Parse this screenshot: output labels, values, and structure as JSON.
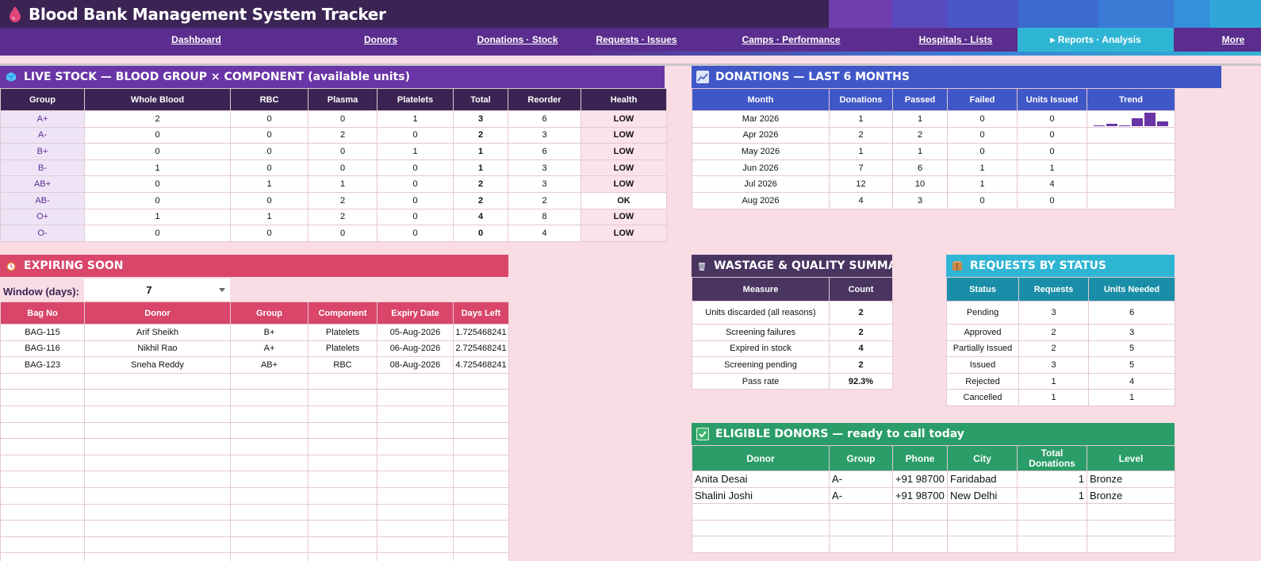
{
  "app": {
    "title": "Blood Bank Management System Tracker"
  },
  "nav": [
    {
      "label": "Dashboard"
    },
    {
      "label": "Donors"
    },
    {
      "label": "Donations · Stock"
    },
    {
      "label": "Requests · Issues"
    },
    {
      "label": "Camps · Performance"
    },
    {
      "label": "Hospitals · Lists"
    },
    {
      "label": "▸ Reports · Analysis"
    },
    {
      "label": "More"
    }
  ],
  "colors": {
    "header_dark": "#3b2453",
    "accent_purple": "#5b2d8e",
    "accent_blue": "#4057c7",
    "expiring_red": "#d9466a",
    "eligible_green": "#2a9d68",
    "requests_teal": "#2fb5d4"
  },
  "live_stock": {
    "title": "LIVE STOCK — BLOOD GROUP × COMPONENT (available units)",
    "icon": "cube-icon",
    "headers": [
      "Group",
      "Whole Blood",
      "RBC",
      "Plasma",
      "Platelets",
      "Total",
      "Reorder",
      "Health"
    ],
    "rows": [
      [
        "A+",
        "2",
        "0",
        "0",
        "1",
        "3",
        "6",
        "LOW"
      ],
      [
        "A-",
        "0",
        "0",
        "2",
        "0",
        "2",
        "3",
        "LOW"
      ],
      [
        "B+",
        "0",
        "0",
        "0",
        "1",
        "1",
        "6",
        "LOW"
      ],
      [
        "B-",
        "1",
        "0",
        "0",
        "0",
        "1",
        "3",
        "LOW"
      ],
      [
        "AB+",
        "0",
        "1",
        "1",
        "0",
        "2",
        "3",
        "LOW"
      ],
      [
        "AB-",
        "0",
        "0",
        "2",
        "0",
        "2",
        "2",
        "OK"
      ],
      [
        "O+",
        "1",
        "1",
        "2",
        "0",
        "4",
        "8",
        "LOW"
      ],
      [
        "O-",
        "0",
        "0",
        "0",
        "0",
        "0",
        "4",
        "LOW"
      ]
    ]
  },
  "donations": {
    "title": "DONATIONS — LAST 6 MONTHS",
    "icon": "chart-icon",
    "headers": [
      "Month",
      "Donations",
      "Passed",
      "Failed",
      "Units Issued",
      "Trend"
    ],
    "rows": [
      [
        "Mar 2026",
        "1",
        "1",
        "0",
        "0"
      ],
      [
        "Apr 2026",
        "2",
        "2",
        "0",
        "0"
      ],
      [
        "May 2026",
        "1",
        "1",
        "0",
        "0"
      ],
      [
        "Jun 2026",
        "7",
        "6",
        "1",
        "1"
      ],
      [
        "Jul 2026",
        "12",
        "10",
        "1",
        "4"
      ],
      [
        "Aug 2026",
        "4",
        "3",
        "0",
        "0"
      ]
    ],
    "trend_values": [
      1,
      2,
      1,
      7,
      12,
      4
    ]
  },
  "expiring": {
    "title": "EXPIRING SOON",
    "icon": "alarm-clock-icon",
    "window_label": "Window (days):",
    "window_value": "7",
    "headers": [
      "Bag No",
      "Donor",
      "Group",
      "Component",
      "Expiry Date",
      "Days Left"
    ],
    "rows": [
      [
        "BAG-115",
        "Arif Sheikh",
        "B+",
        "Platelets",
        "05-Aug-2026",
        "1.725468241"
      ],
      [
        "BAG-116",
        "Nikhil Rao",
        "A+",
        "Platelets",
        "06-Aug-2026",
        "2.725468241"
      ],
      [
        "BAG-123",
        "Sneha Reddy",
        "AB+",
        "RBC",
        "08-Aug-2026",
        "4.725468241"
      ]
    ]
  },
  "wastage": {
    "title": "WASTAGE & QUALITY SUMMARY",
    "icon": "wastebasket-icon",
    "headers": [
      "Measure",
      "Count"
    ],
    "rows": [
      [
        "Units discarded (all reasons)",
        "2"
      ],
      [
        "Screening failures",
        "2"
      ],
      [
        "Expired in stock",
        "4"
      ],
      [
        "Screening pending",
        "2"
      ],
      [
        "Pass rate",
        "92.3%"
      ]
    ]
  },
  "requests": {
    "title": "REQUESTS BY STATUS",
    "icon": "package-icon",
    "headers": [
      "Status",
      "Requests",
      "Units Needed"
    ],
    "rows": [
      [
        "Pending",
        "3",
        "6"
      ],
      [
        "Approved",
        "2",
        "3"
      ],
      [
        "Partially Issued",
        "2",
        "5"
      ],
      [
        "Issued",
        "3",
        "5"
      ],
      [
        "Rejected",
        "1",
        "4"
      ],
      [
        "Cancelled",
        "1",
        "1"
      ]
    ]
  },
  "eligible": {
    "title": "ELIGIBLE DONORS — ready to call today",
    "icon": "check-box-icon",
    "headers": [
      "Donor",
      "Group",
      "Phone",
      "City",
      "Total Donations",
      "Level"
    ],
    "rows": [
      [
        "Anita Desai",
        "A-",
        "+91 98700",
        "Faridabad",
        "1",
        "Bronze"
      ],
      [
        "Shalini Joshi",
        "A-",
        "+91 98700",
        "New Delhi",
        "1",
        "Bronze"
      ]
    ]
  }
}
